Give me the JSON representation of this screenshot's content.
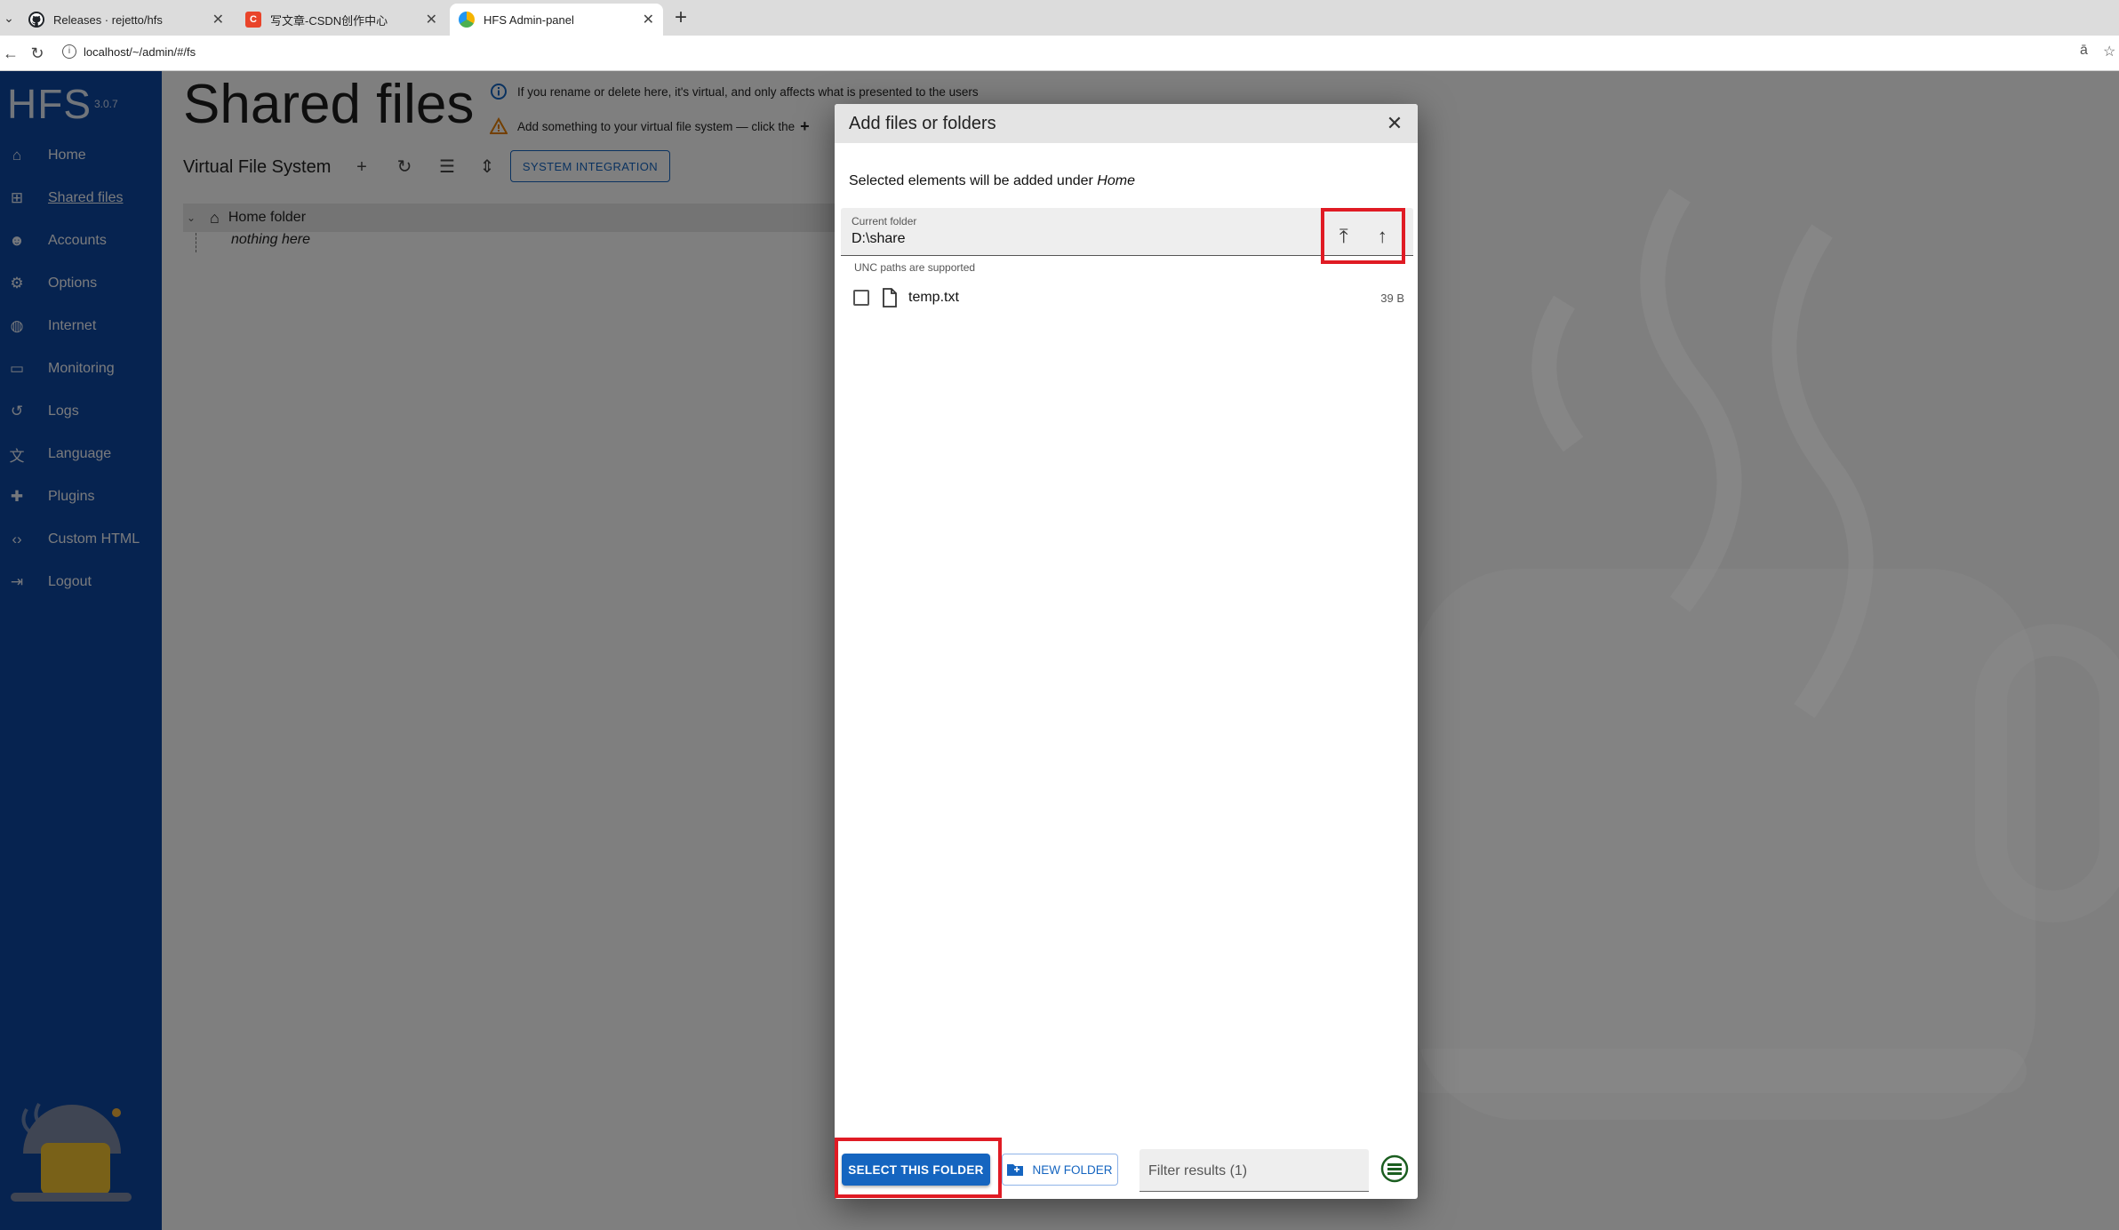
{
  "browser": {
    "tabs": [
      {
        "title": "Releases · rejetto/hfs",
        "icon": "github-icon",
        "active": false
      },
      {
        "title": "写文章-CSDN创作中心",
        "icon": "csdn-icon",
        "active": false
      },
      {
        "title": "HFS Admin-panel",
        "icon": "hfs-icon",
        "active": true
      }
    ],
    "url": "localhost/~/admin/#/fs"
  },
  "sidebar": {
    "logo": "HFS",
    "version": "3.0.7",
    "items": [
      {
        "label": "Home",
        "icon": "home-icon",
        "active": false
      },
      {
        "label": "Shared files",
        "icon": "file-tree-icon",
        "active": true
      },
      {
        "label": "Accounts",
        "icon": "accounts-icon",
        "active": false
      },
      {
        "label": "Options",
        "icon": "gear-icon",
        "active": false
      },
      {
        "label": "Internet",
        "icon": "globe-icon",
        "active": false
      },
      {
        "label": "Monitoring",
        "icon": "monitor-icon",
        "active": false
      },
      {
        "label": "Logs",
        "icon": "history-icon",
        "active": false
      },
      {
        "label": "Language",
        "icon": "translate-icon",
        "active": false
      },
      {
        "label": "Plugins",
        "icon": "puzzle-icon",
        "active": false
      },
      {
        "label": "Custom HTML",
        "icon": "code-icon",
        "active": false
      },
      {
        "label": "Logout",
        "icon": "logout-icon",
        "active": false
      }
    ]
  },
  "main": {
    "title": "Shared files",
    "hint_info": "If you rename or delete here, it's virtual, and only affects what is presented to the users",
    "hint_warning": "Add something to your virtual file system — click the",
    "vfs_title": "Virtual File System",
    "system_integration": "SYSTEM INTEGRATION",
    "tree_root": "Home folder",
    "tree_empty": "nothing here"
  },
  "dialog": {
    "title": "Add files or folders",
    "subtitle_prefix": "Selected elements will be added under",
    "subtitle_target": "Home",
    "folder_label": "Current folder",
    "folder_value": "D:\\share",
    "unc_note": "UNC paths are supported",
    "files": [
      {
        "name": "temp.txt",
        "size": "39 B",
        "checked": false
      }
    ],
    "select_button": "SELECT THIS FOLDER",
    "new_folder_button": "NEW FOLDER",
    "filter_placeholder": "Filter results (1)"
  },
  "colors": {
    "sidebar_bg": "#0d47a1",
    "primary": "#1565c0",
    "highlight_border": "#e01b24"
  }
}
